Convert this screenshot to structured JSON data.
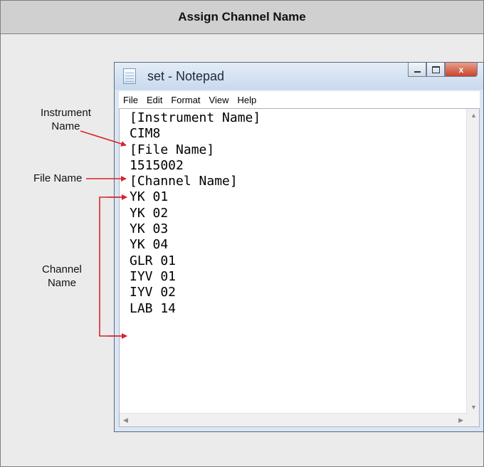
{
  "banner": {
    "title": "Assign Channel Name"
  },
  "window": {
    "title": "set - Notepad",
    "controls": {
      "close": "x"
    },
    "menu": [
      "File",
      "Edit",
      "Format",
      "View",
      "Help"
    ],
    "lines": [
      "[Instrument Name]",
      "CIM8",
      "[File Name]",
      "1515002",
      "[Channel Name]",
      "YK 01",
      "YK 02",
      "YK 03",
      "YK 04",
      "GLR 01",
      "IYV 01",
      "IYV 02",
      "LAB 14"
    ]
  },
  "annotations": {
    "instrument": [
      "Instrument",
      "Name"
    ],
    "file": "File Name",
    "channel": [
      "Channel",
      "Name"
    ],
    "arrow_color": "#d9232b"
  }
}
